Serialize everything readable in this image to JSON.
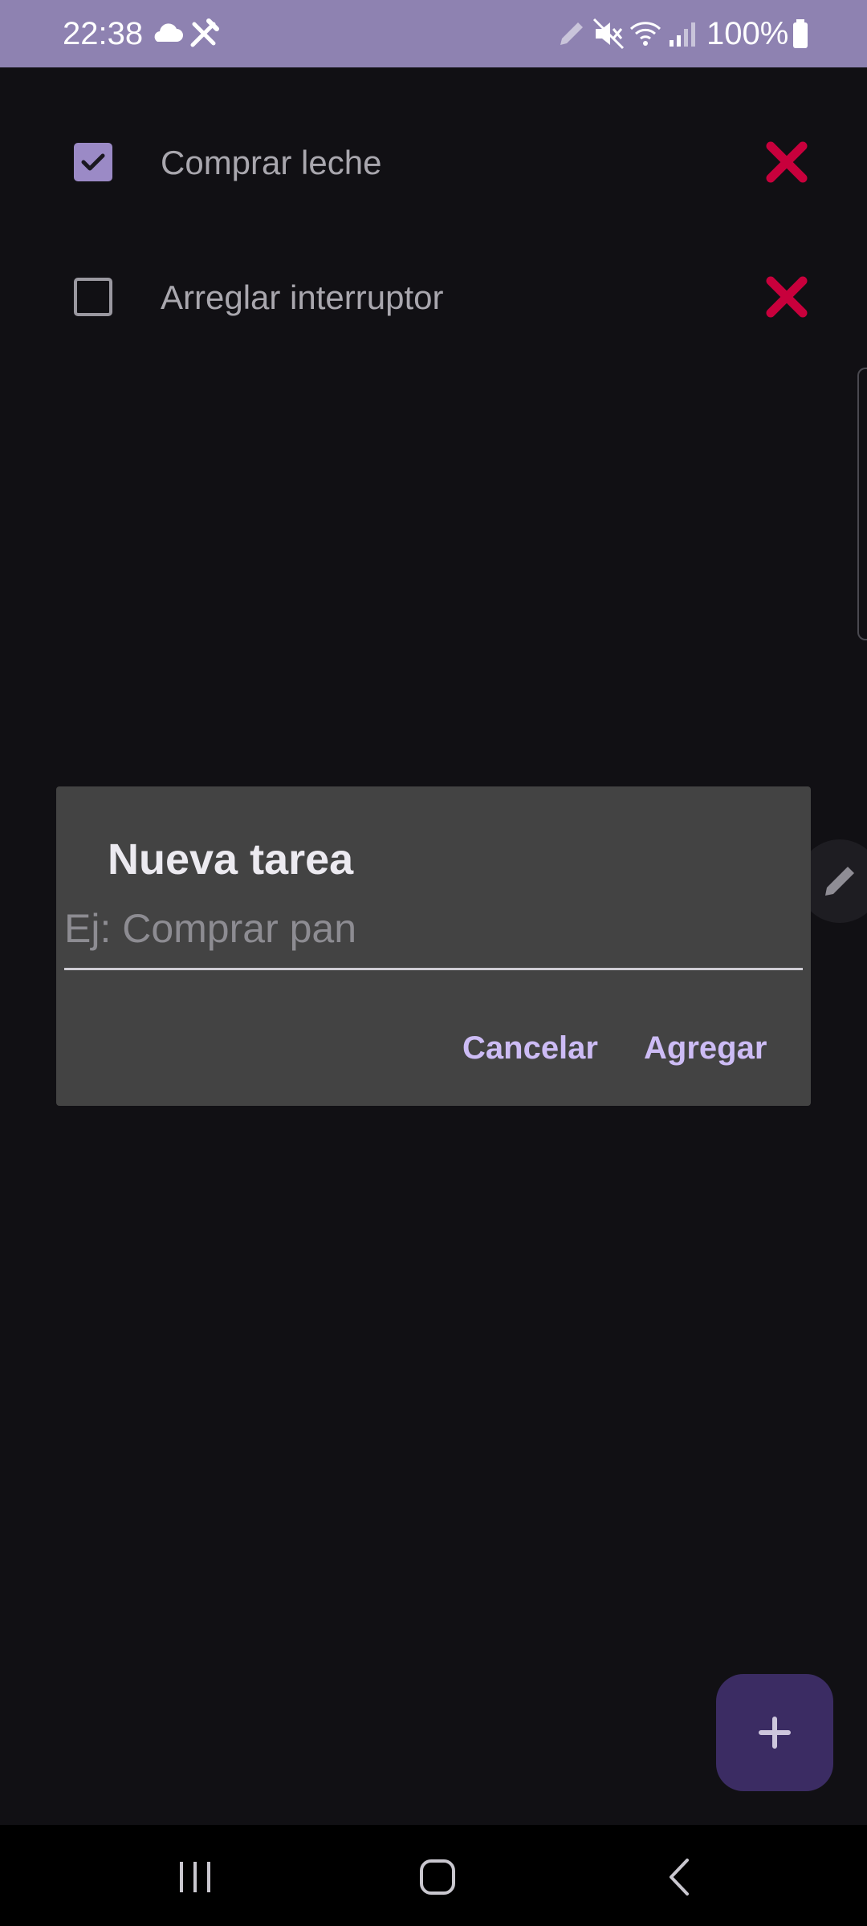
{
  "status_bar": {
    "time": "22:38",
    "battery": "100%",
    "bg_color": "#8e82b1",
    "left_icons": [
      "cloud-icon",
      "tools-icon"
    ],
    "right_icons": [
      "pen-icon",
      "mute-icon",
      "wifi-icon",
      "signal-icon",
      "battery-icon"
    ]
  },
  "tasks": [
    {
      "label": "Comprar leche",
      "checked": true
    },
    {
      "label": "Arreglar interruptor",
      "checked": false
    }
  ],
  "dialog": {
    "title": "Nueva tarea",
    "input_placeholder": "Ej: Comprar pan",
    "input_value": "",
    "cancel_label": "Cancelar",
    "add_label": "Agregar"
  },
  "fab": {
    "icon": "plus-icon",
    "color": "#3b2c63"
  },
  "colors": {
    "background": "#111014",
    "checkbox_checked": "#9b8ac6",
    "delete": "#c8003c",
    "accent_text": "#cdbcf5",
    "dialog_bg": "#434343"
  },
  "nav_bar": {
    "icons": [
      "recent-apps-icon",
      "home-icon",
      "back-icon"
    ]
  }
}
